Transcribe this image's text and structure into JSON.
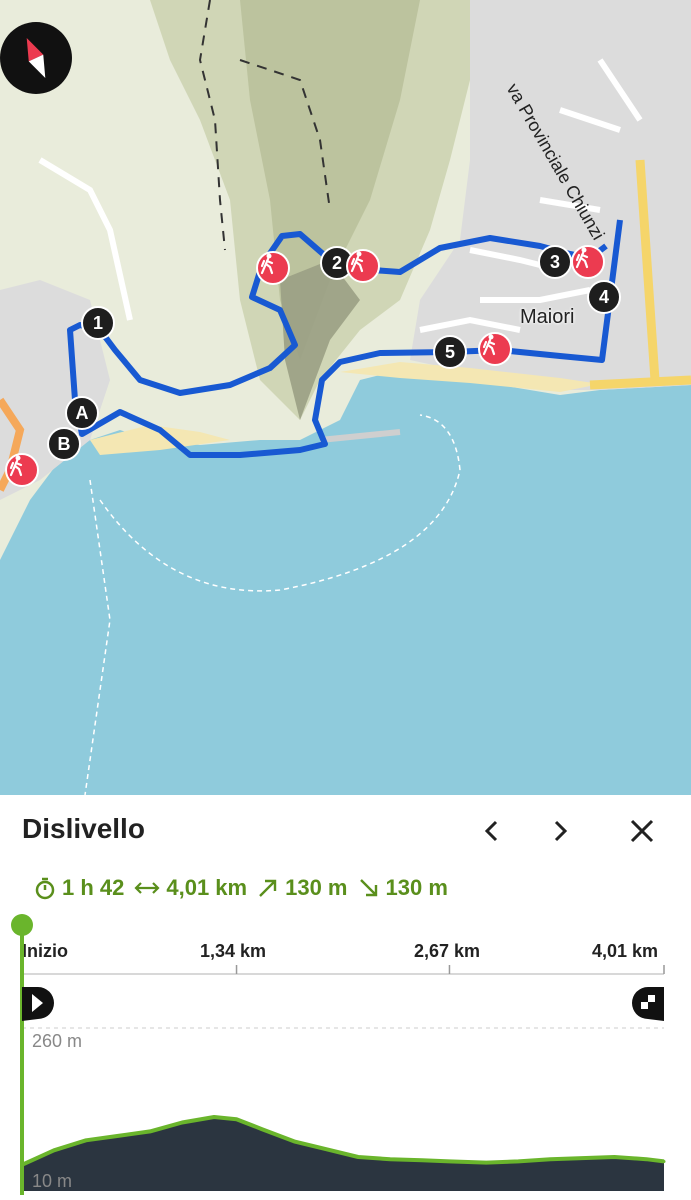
{
  "map": {
    "town_label": "Maiori",
    "road_label": "va Provinciale Chiunzi",
    "waypoints": [
      "A",
      "B",
      "1",
      "2",
      "3",
      "4",
      "5"
    ],
    "poi_icon": "hiker-icon",
    "compass_icon": "compass-icon"
  },
  "panel": {
    "title": "Dislivello",
    "prev_icon": "chevron-left-icon",
    "next_icon": "chevron-right-icon",
    "close_icon": "close-icon",
    "stats": {
      "duration": "1 h 42",
      "distance": "4,01 km",
      "ascent": "130 m",
      "descent": "130 m"
    },
    "axis": {
      "start": "Inizio",
      "mark1": "1,34 km",
      "mark2": "2,67 km",
      "end": "4,01 km"
    },
    "elev_max": "260 m",
    "elev_min": "10 m",
    "colors": {
      "accent": "#5a8f1c",
      "route": "#1859d2",
      "profile_fill": "#2b3540",
      "water": "#8fcbdc",
      "land": "#e9ecdb"
    }
  },
  "chart_data": {
    "type": "area",
    "xlabel": "",
    "ylabel": "",
    "x": [
      0,
      0.2,
      0.4,
      0.6,
      0.8,
      1.0,
      1.2,
      1.34,
      1.5,
      1.7,
      1.9,
      2.1,
      2.3,
      2.5,
      2.67,
      2.9,
      3.1,
      3.3,
      3.5,
      3.7,
      3.9,
      4.01
    ],
    "y": [
      14,
      40,
      58,
      66,
      74,
      90,
      100,
      96,
      78,
      56,
      42,
      28,
      24,
      22,
      20,
      18,
      20,
      24,
      26,
      28,
      24,
      20
    ],
    "xlim": [
      0,
      4.01
    ],
    "ylim": [
      10,
      260
    ]
  }
}
